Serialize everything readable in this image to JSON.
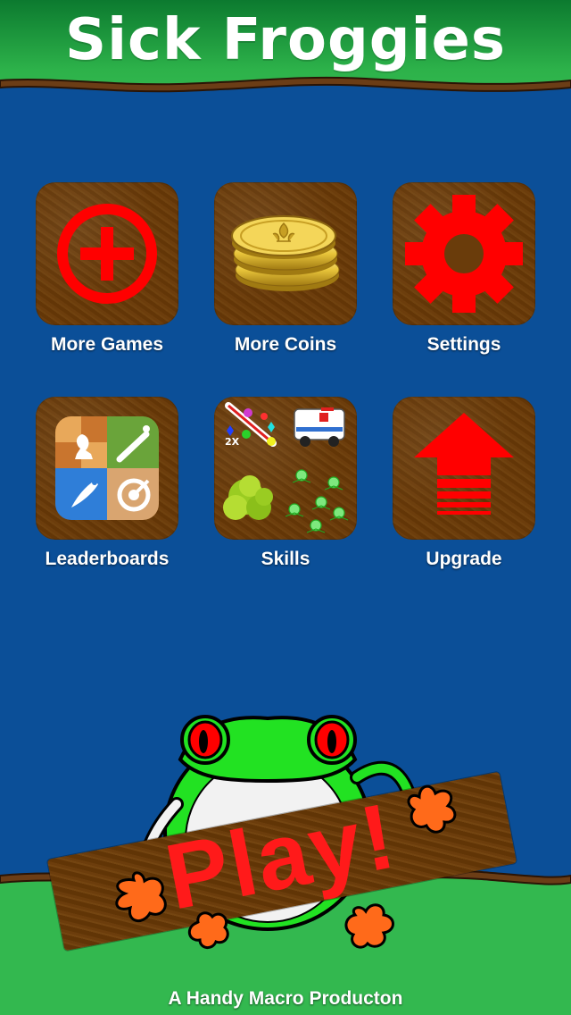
{
  "app": {
    "title": "Sick Froggies",
    "credit": "A Handy Macro Producton"
  },
  "menu": {
    "items": [
      {
        "id": "more-games",
        "label": "More Games",
        "icon": "plus-circle-icon"
      },
      {
        "id": "more-coins",
        "label": "More Coins",
        "icon": "coins-icon"
      },
      {
        "id": "settings",
        "label": "Settings",
        "icon": "gear-icon"
      },
      {
        "id": "leaderboards",
        "label": "Leaderboards",
        "icon": "game-center-icon"
      },
      {
        "id": "skills",
        "label": "Skills",
        "icon": "skills-montage-icon"
      },
      {
        "id": "upgrade",
        "label": "Upgrade",
        "icon": "up-arrow-icon"
      }
    ]
  },
  "play": {
    "label": "Play!"
  },
  "colors": {
    "background_blue": "#0b4f98",
    "grass_green": "#33b84f",
    "wood_brown": "#6c3d0c",
    "icon_red": "#ff0000",
    "play_red": "#ff1a1a"
  }
}
